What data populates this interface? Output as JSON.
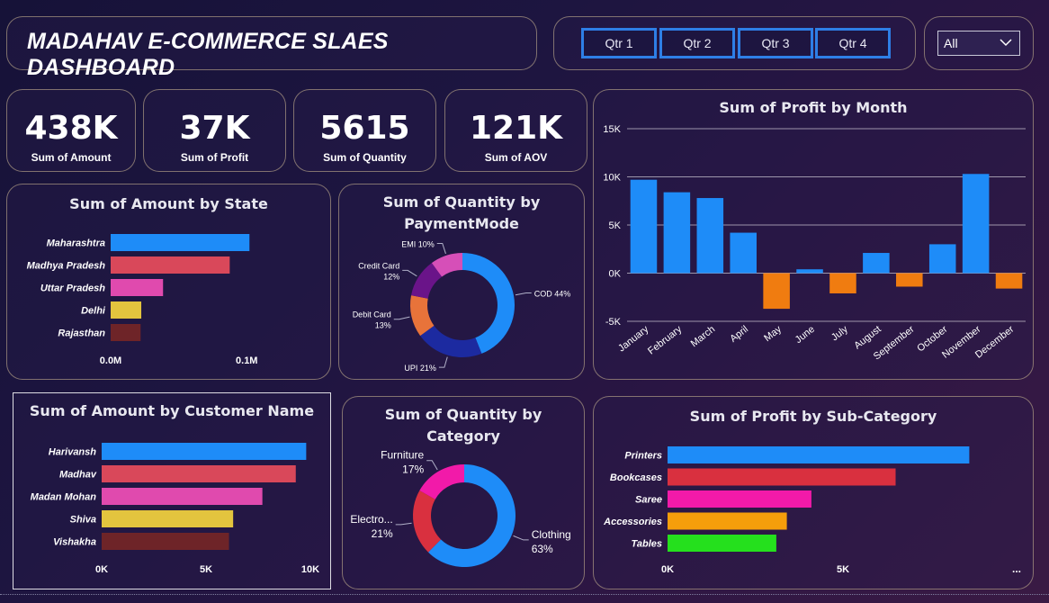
{
  "header": {
    "title": "MADAHAV E-COMMERCE SLAES DASHBOARD"
  },
  "quarters": [
    "Qtr 1",
    "Qtr 2",
    "Qtr 3",
    "Qtr 4"
  ],
  "filter": {
    "selected": "All"
  },
  "kpis": [
    {
      "value": "438K",
      "label": "Sum of Amount"
    },
    {
      "value": "37K",
      "label": "Sum of Profit"
    },
    {
      "value": "5615",
      "label": "Sum of Quantity"
    },
    {
      "value": "121K",
      "label": "Sum of AOV"
    }
  ],
  "chart_data": [
    {
      "id": "amount_by_state",
      "type": "bar",
      "orientation": "horizontal",
      "title": "Sum of Amount by State",
      "categories": [
        "Maharashtra",
        "Madhya Pradesh",
        "Uttar Pradesh",
        "Delhi",
        "Rajasthan"
      ],
      "values": [
        102000,
        87500,
        38500,
        22500,
        22000
      ],
      "colors": [
        "#1e8cf8",
        "#d9485a",
        "#e04aae",
        "#e3c43e",
        "#6e2428"
      ],
      "xlim": [
        0,
        160000
      ],
      "xticks": [
        {
          "value": 0,
          "label": "0.0M"
        },
        {
          "value": 100000,
          "label": "0.1M"
        }
      ]
    },
    {
      "id": "quantity_by_paymentmode",
      "type": "pie",
      "donut": true,
      "title": "Sum of Quantity by PaymentMode",
      "labels": [
        "COD",
        "UPI",
        "Debit Card",
        "Credit Card",
        "EMI"
      ],
      "values": [
        44,
        21,
        13,
        12,
        10
      ],
      "display": [
        "COD 44%",
        "UPI 21%",
        "Debit Card 13%",
        "Credit Card 12%",
        "EMI 10%"
      ],
      "colors": [
        "#1e8cf8",
        "#1c2aa0",
        "#e8733a",
        "#6a1489",
        "#d64fb8"
      ]
    },
    {
      "id": "profit_by_month",
      "type": "bar",
      "title": "Sum of Profit by Month",
      "categories": [
        "January",
        "February",
        "March",
        "April",
        "May",
        "June",
        "July",
        "August",
        "September",
        "October",
        "November",
        "December"
      ],
      "values": [
        9700,
        8400,
        7800,
        4200,
        -3700,
        400,
        -2100,
        2100,
        -1400,
        3000,
        10300,
        -1600
      ],
      "positive_color": "#1e8cf8",
      "negative_color": "#f07c10",
      "ylim": [
        -5000,
        15000
      ],
      "yticks": [
        {
          "value": 15000,
          "label": "15K"
        },
        {
          "value": 10000,
          "label": "10K"
        },
        {
          "value": 5000,
          "label": "5K"
        },
        {
          "value": 0,
          "label": "0K"
        },
        {
          "value": -5000,
          "label": "-5K"
        }
      ]
    },
    {
      "id": "amount_by_customer",
      "type": "bar",
      "orientation": "horizontal",
      "title": "Sum of Amount by Customer Name",
      "categories": [
        "Harivansh",
        "Madhav",
        "Madan Mohan",
        "Shiva",
        "Vishakha"
      ],
      "values": [
        9800,
        9300,
        7700,
        6300,
        6100
      ],
      "colors": [
        "#1e8cf8",
        "#d9485a",
        "#e04aae",
        "#e3c43e",
        "#6e2428"
      ],
      "xlim": [
        0,
        10000
      ],
      "xticks": [
        {
          "value": 0,
          "label": "0K"
        },
        {
          "value": 5000,
          "label": "5K"
        },
        {
          "value": 10000,
          "label": "10K"
        }
      ]
    },
    {
      "id": "quantity_by_category",
      "type": "pie",
      "donut": true,
      "title": "Sum of Quantity by Category",
      "labels": [
        "Clothing",
        "Electronics",
        "Furniture"
      ],
      "values": [
        63,
        21,
        17
      ],
      "display_name": [
        "Clothing",
        "Electro...",
        "Furniture"
      ],
      "display_pct": [
        "63%",
        "21%",
        "17%"
      ],
      "colors": [
        "#1e8cf8",
        "#d9303f",
        "#f21aa9"
      ]
    },
    {
      "id": "profit_by_subcategory",
      "type": "bar",
      "orientation": "horizontal",
      "title": "Sum of Profit by Sub-Category",
      "categories": [
        "Printers",
        "Bookcases",
        "Saree",
        "Accessories",
        "Tables"
      ],
      "values": [
        8600,
        6500,
        4100,
        3400,
        3100
      ],
      "colors": [
        "#1e8cf8",
        "#d9303f",
        "#f21aa9",
        "#f59e0b",
        "#25e01d"
      ],
      "xlim": [
        0,
        10000
      ],
      "xticks": [
        {
          "value": 0,
          "label": "0K"
        },
        {
          "value": 5000,
          "label": "5K"
        }
      ],
      "overflow_label": "..."
    }
  ]
}
